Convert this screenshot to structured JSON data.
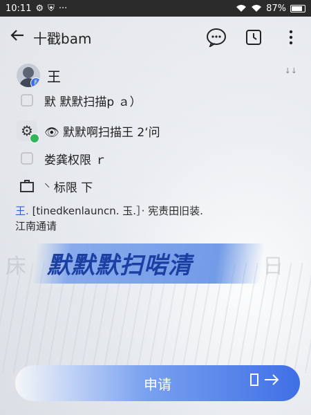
{
  "status_bar": {
    "time": "10:11",
    "battery": "87%",
    "bg_color": "#2b2b2b"
  },
  "header": {
    "back_icon": "arrow-left",
    "title": "十戳bam",
    "actions": [
      "chat-bubble-icon",
      "timer-icon",
      "more-vertical-icon"
    ]
  },
  "contact": {
    "name": "王",
    "badge": "F",
    "hint": "↓↓"
  },
  "rows": [
    {
      "icon": "ghost-icon",
      "text": "默 默默扫描p ａ）"
    },
    {
      "icon": "settings-icon",
      "text": "👁 默默啊扫描王 2ʻ问"
    },
    {
      "icon": "ghost-icon",
      "text": "娄龚权限 ｒ"
    },
    {
      "icon": "tray-icon",
      "text": "⸌ 标限 下"
    }
  ],
  "footnote": {
    "line1_prefix": "王.",
    "line1_mid": "[tinedkenlauncn.",
    "line1_mid2": "玉.］·",
    "line1_suffix": "宪责田旧装.",
    "line2": "江南通请"
  },
  "banner": {
    "text": "默默默扫啱清",
    "color": "#1c3fa3"
  },
  "ghost_chars": [
    "床",
    "日"
  ],
  "apply_button": {
    "label": "申请",
    "accent": "#3f6fe6"
  }
}
